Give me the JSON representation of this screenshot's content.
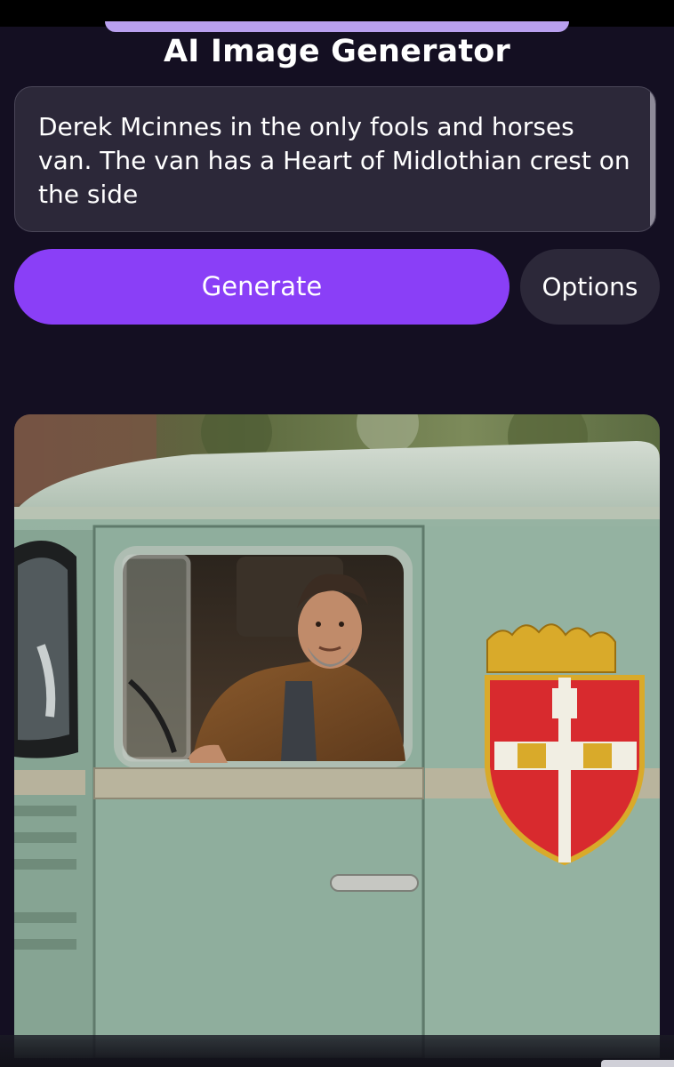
{
  "header": {
    "title": "AI Image Generator"
  },
  "prompt": {
    "text": "Derek Mcinnes in the only fools and horses van. The van has a Heart of Midlothian crest on the side"
  },
  "actions": {
    "generate_label": "Generate",
    "options_label": "Options"
  },
  "result": {
    "image_description": "man-in-green-van-with-crest"
  },
  "colors": {
    "background": "#140f22",
    "accent": "#8a3ff7",
    "surface": "#2c2839"
  }
}
